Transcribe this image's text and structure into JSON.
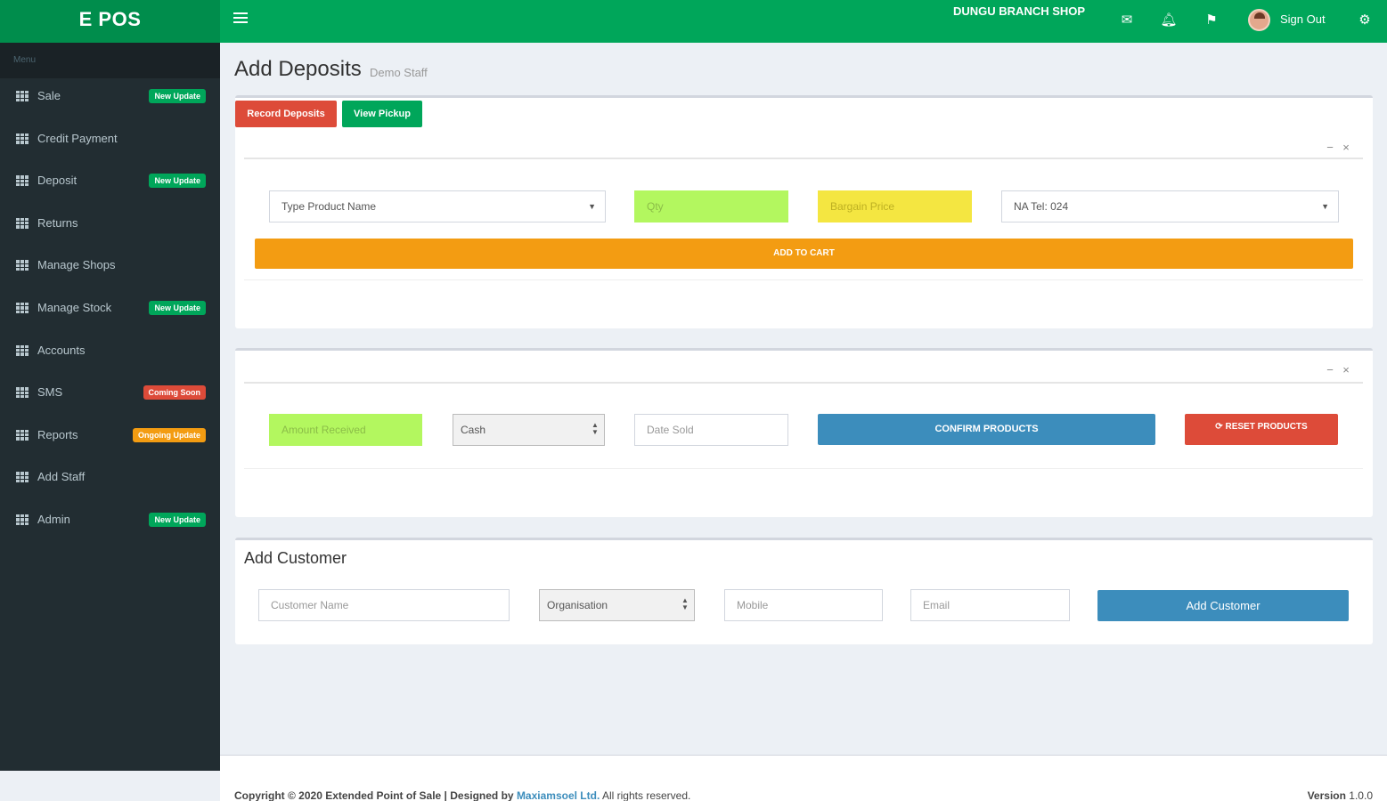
{
  "app": {
    "logo": "E POS",
    "shop_name": "DUNGU BRANCH SHOP",
    "sign_out": "Sign Out"
  },
  "sidebar": {
    "header": "Menu",
    "items": [
      {
        "label": "Sale",
        "badge": "New Update",
        "badge_color": "#00a65a"
      },
      {
        "label": "Credit Payment"
      },
      {
        "label": "Deposit",
        "badge": "New Update",
        "badge_color": "#00a65a"
      },
      {
        "label": "Returns"
      },
      {
        "label": "Manage Shops"
      },
      {
        "label": "Manage Stock",
        "badge": "New Update",
        "badge_color": "#00a65a"
      },
      {
        "label": "Accounts"
      },
      {
        "label": "SMS",
        "badge": "Coming Soon",
        "badge_color": "#dd4b39"
      },
      {
        "label": "Reports",
        "badge": "Ongoing Update",
        "badge_color": "#f39c12"
      },
      {
        "label": "Add Staff"
      },
      {
        "label": "Admin",
        "badge": "New Update",
        "badge_color": "#00a65a"
      }
    ]
  },
  "page": {
    "title": "Add Deposits",
    "subtitle": "Demo Staff"
  },
  "actions": {
    "record_deposits": "Record Deposits",
    "view_pickup": "View Pickup"
  },
  "product_form": {
    "product_placeholder": "Type Product Name",
    "qty_placeholder": "Qty",
    "bargain_placeholder": "Bargain Price",
    "account_value": "NA Tel: 024",
    "add_to_cart": "ADD TO CART"
  },
  "payment_form": {
    "amount_placeholder": "Amount Received",
    "payment_method": "Cash",
    "date_placeholder": "Date Sold",
    "confirm": "CONFIRM PRODUCTS",
    "reset": "RESET PRODUCTS"
  },
  "customer_form": {
    "title": "Add Customer",
    "name_placeholder": "Customer Name",
    "organisation": "Organisation",
    "mobile_placeholder": "Mobile",
    "email_placeholder": "Email",
    "submit": "Add Customer"
  },
  "footer": {
    "copyright": "Copyright © 2020 Extended Point of Sale | Designed by",
    "brand": "Maxiamsoel Ltd.",
    "rights": "All rights reserved.",
    "version_label": "Version",
    "version": "1.0.0"
  },
  "colors": {
    "header": "#00a65a",
    "sidebar": "#222d32",
    "add_to_cart": "#f39c12",
    "confirm": "#3c8dbc",
    "reset": "#dd4b39"
  }
}
